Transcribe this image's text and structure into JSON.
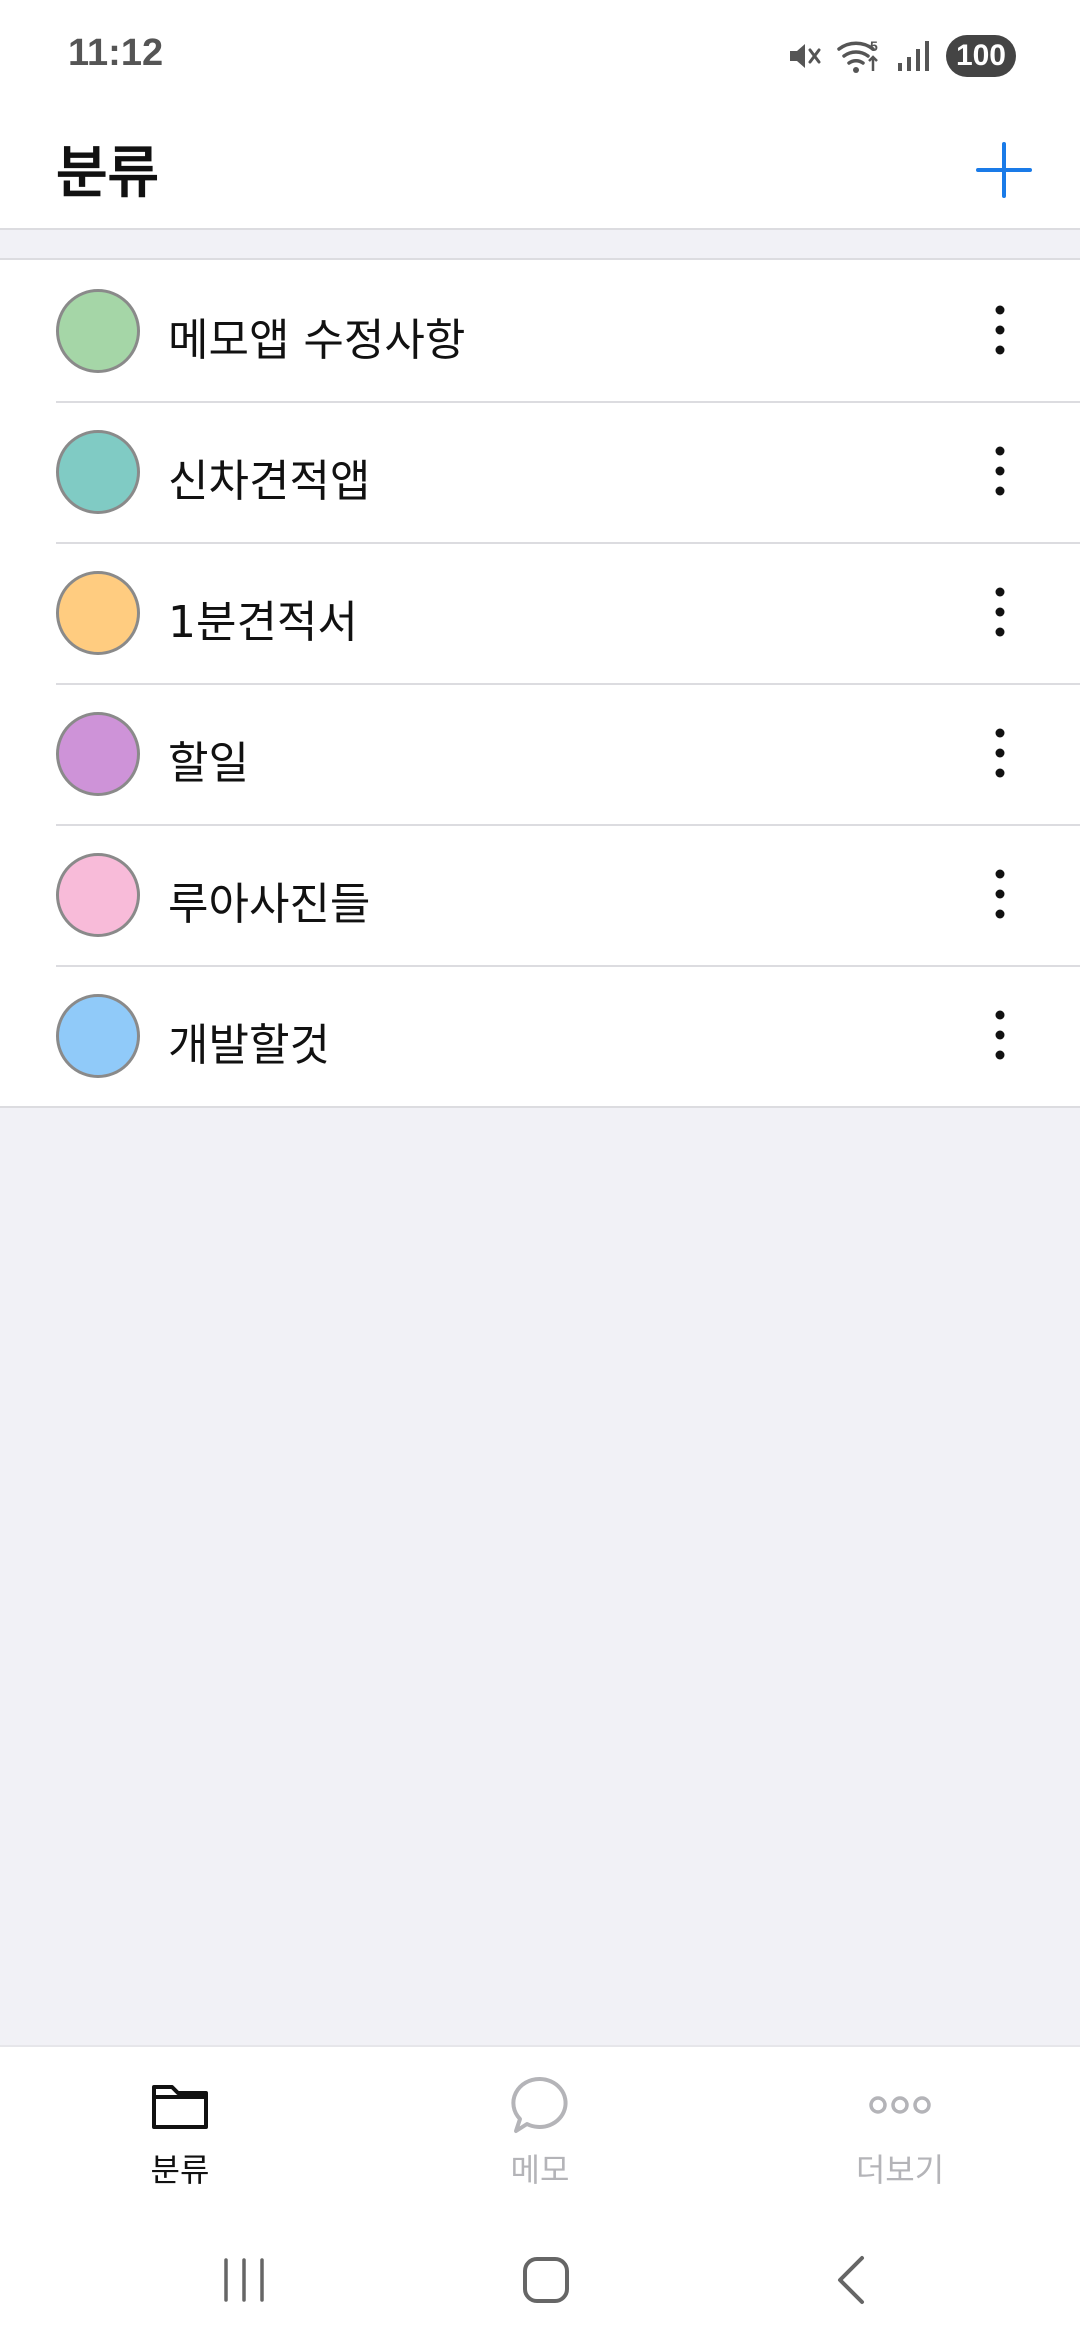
{
  "status_bar": {
    "time": "11:12",
    "battery": "100",
    "icons": [
      "mute-icon",
      "wifi-icon",
      "signal-icon",
      "battery-icon"
    ]
  },
  "header": {
    "title": "분류",
    "add_icon": "plus-icon",
    "accent_color": "#1a7be8"
  },
  "categories": [
    {
      "name": "메모앱 수정사항",
      "color": "#a5d6a7"
    },
    {
      "name": "신차견적앱",
      "color": "#80cbc4"
    },
    {
      "name": "1분견적서",
      "color": "#ffcc80"
    },
    {
      "name": "할일",
      "color": "#ce93d8"
    },
    {
      "name": "루아사진들",
      "color": "#f8bbd9"
    },
    {
      "name": "개발할것",
      "color": "#90caf9"
    }
  ],
  "tab_bar": {
    "tabs": [
      {
        "label": "분류",
        "icon": "folder-icon",
        "active": true
      },
      {
        "label": "메모",
        "icon": "chat-bubble-icon",
        "active": false
      },
      {
        "label": "더보기",
        "icon": "more-dots-icon",
        "active": false
      }
    ]
  },
  "nav_bar": {
    "buttons": [
      "recent-apps-icon",
      "home-icon",
      "back-icon"
    ]
  }
}
